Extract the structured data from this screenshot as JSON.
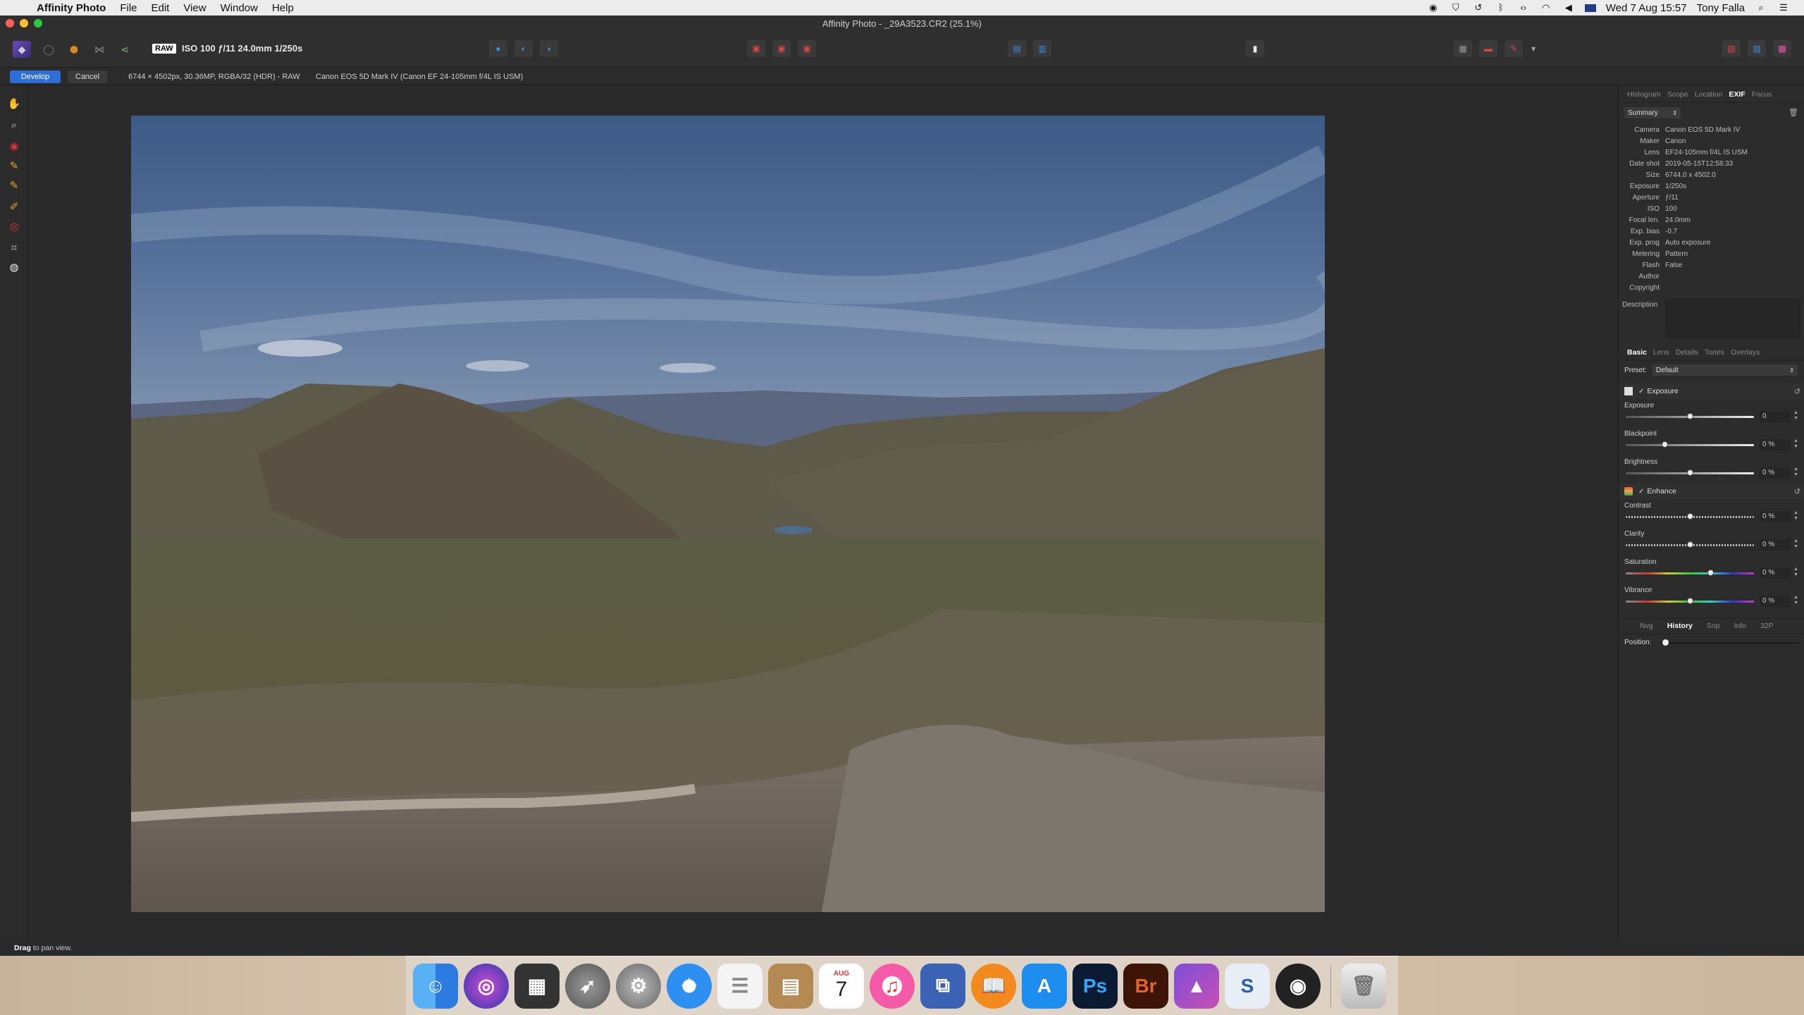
{
  "menubar": {
    "app_name": "Affinity Photo",
    "menus": [
      "File",
      "Edit",
      "View",
      "Window",
      "Help"
    ],
    "clock": "Wed 7 Aug  15:57",
    "user": "Tony Falla"
  },
  "window": {
    "title": "Affinity Photo - _29A3523.CR2 (25.1%)"
  },
  "toolbar": {
    "raw_badge": "RAW",
    "raw_info": "ISO 100 ƒ/11 24.0mm 1/250s"
  },
  "context": {
    "develop_label": "Develop",
    "cancel_label": "Cancel",
    "image_info": "6744 × 4502px, 30.36MP, RGBA/32 (HDR) - RAW",
    "camera_info": "Canon EOS 5D Mark IV (Canon EF 24-105mm f/4L IS USM)"
  },
  "info_panel": {
    "tabs": [
      "Histogram",
      "Scope",
      "Location",
      "EXIF",
      "Focus"
    ],
    "active_tab": "EXIF",
    "summary_select": "Summary",
    "exif": [
      {
        "k": "Camera",
        "v": "Canon EOS 5D Mark IV"
      },
      {
        "k": "Maker",
        "v": "Canon"
      },
      {
        "k": "Lens",
        "v": "EF24-105mm f/4L IS USM"
      },
      {
        "k": "Date shot",
        "v": "2019-05-15T12:58:33"
      },
      {
        "k": "Size",
        "v": "6744.0 x 4502.0"
      },
      {
        "k": "Exposure",
        "v": "1/250s"
      },
      {
        "k": "Aperture",
        "v": "ƒ/11"
      },
      {
        "k": "ISO",
        "v": "100"
      },
      {
        "k": "Focal len.",
        "v": "24.0mm"
      },
      {
        "k": "Exp. bias",
        "v": "-0.7"
      },
      {
        "k": "Exp. prog",
        "v": "Auto exposure"
      },
      {
        "k": "Metering",
        "v": "Pattern"
      },
      {
        "k": "Flash",
        "v": "False"
      },
      {
        "k": "Author",
        "v": ""
      },
      {
        "k": "Copyright",
        "v": ""
      }
    ],
    "description_label": "Description"
  },
  "develop_panel": {
    "tabs": [
      "Basic",
      "Lens",
      "Details",
      "Tones",
      "Overlays"
    ],
    "active_tab": "Basic",
    "preset_label": "Preset:",
    "preset_value": "Default",
    "exposure_group": "Exposure",
    "enhance_group": "Enhance",
    "sliders": {
      "exposure": {
        "label": "Exposure",
        "value": "0",
        "pos": 0.5
      },
      "blackpoint": {
        "label": "Blackpoint",
        "value": "0 %",
        "pos": 0.3
      },
      "brightness": {
        "label": "Brightness",
        "value": "0 %",
        "pos": 0.5
      },
      "contrast": {
        "label": "Contrast",
        "value": "0 %",
        "pos": 0.5
      },
      "clarity": {
        "label": "Clarity",
        "value": "0 %",
        "pos": 0.5
      },
      "saturation": {
        "label": "Saturation",
        "value": "0 %",
        "pos": 0.66
      },
      "vibrance": {
        "label": "Vibrance",
        "value": "0 %",
        "pos": 0.5
      }
    }
  },
  "history_panel": {
    "tabs": [
      "Nvg",
      "History",
      "Snp",
      "Info",
      "32P"
    ],
    "active_tab": "History",
    "position_label": "Position:"
  },
  "status": {
    "bold": "Drag",
    "text": " to pan view."
  },
  "dock": {
    "photoshop_label": "Ps",
    "bridge_label": "Br",
    "calendar_month": "AUG",
    "calendar_day": "7"
  },
  "colors": {
    "accent": "#2d6fd6",
    "panel_bg": "#2c2c2c",
    "canvas_bg": "#2a2a2a"
  }
}
